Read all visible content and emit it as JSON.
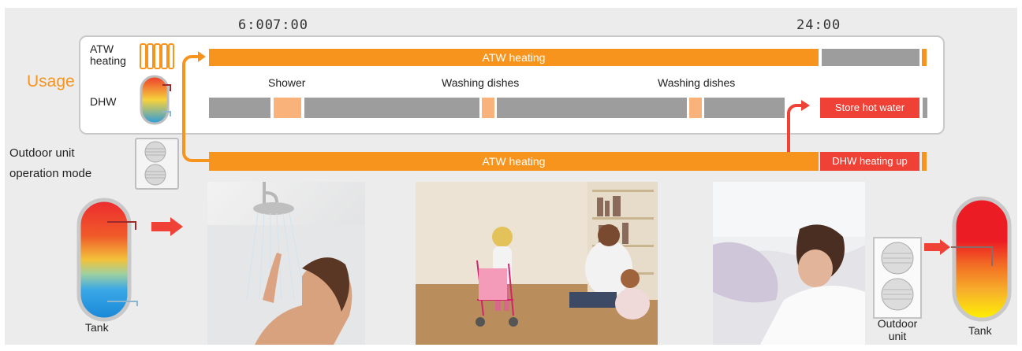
{
  "times": {
    "t1": "6:00",
    "t2": "7:00",
    "t3": "24:00"
  },
  "usage_label": "Usage",
  "labels": {
    "atw_line1": "ATW",
    "atw_line2": "heating",
    "dhw": "DHW",
    "outdoor_line1": "Outdoor unit",
    "outdoor_line2": "operation mode"
  },
  "bars": {
    "atw_top": "ATW heating",
    "atw_bottom": "ATW heating",
    "store": "Store hot water",
    "dhw_up": "DHW heating up"
  },
  "events": {
    "shower": "Shower",
    "dishes1": "Washing dishes",
    "dishes2": "Washing dishes"
  },
  "bottom": {
    "tank_left": "Tank",
    "outdoor_line1": "Outdoor",
    "outdoor_line2": "unit",
    "tank_right": "Tank"
  },
  "colors": {
    "orange": "#f7941d",
    "gray": "#9d9d9d",
    "red": "#ef4136",
    "peach": "#f9b27a",
    "panel": "#ececec"
  }
}
